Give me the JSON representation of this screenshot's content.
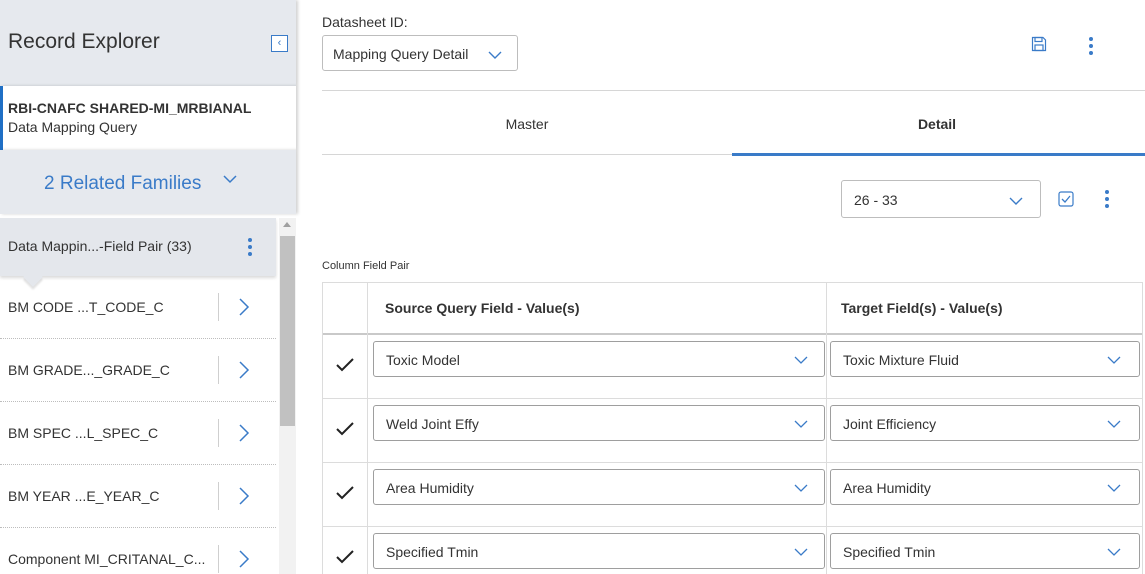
{
  "explorer": {
    "title": "Record Explorer",
    "record": {
      "id": "RBI-CNAFC SHARED-MI_MRBIANAL",
      "type": "Data Mapping Query"
    },
    "related_families_label": "2 Related Families",
    "families": [
      {
        "label": "Data Mappin...-Field Pair",
        "count": "(33)",
        "active": true
      },
      {
        "label": "BM CODE ...T_CODE_C"
      },
      {
        "label": "BM GRADE..._GRADE_C"
      },
      {
        "label": "BM SPEC ...L_SPEC_C"
      },
      {
        "label": "BM YEAR ...E_YEAR_C"
      },
      {
        "label": "Component MI_CRITANAL_C..."
      }
    ]
  },
  "datasheet": {
    "label": "Datasheet ID:",
    "selected": "Mapping Query Detail"
  },
  "tabs": [
    {
      "label": "Master",
      "active": false
    },
    {
      "label": "Detail",
      "active": true
    }
  ],
  "range_select": {
    "value": "26 - 33"
  },
  "section_label": "Column Field Pair",
  "grid": {
    "headers": [
      "Source Query Field - Value(s)",
      "Target Field(s) - Value(s)"
    ],
    "rows": [
      {
        "checked": true,
        "source": "Toxic Model",
        "target": "Toxic Mixture Fluid"
      },
      {
        "checked": true,
        "source": "Weld Joint Effy",
        "target": "Joint Efficiency"
      },
      {
        "checked": true,
        "source": "Area Humidity",
        "target": "Area Humidity"
      },
      {
        "checked": true,
        "source": "Specified Tmin",
        "target": "Specified Tmin"
      }
    ]
  },
  "colors": {
    "accent": "#3a7bc8",
    "panel_bg": "#e6e9ee",
    "active_border": "#1f6fc5"
  },
  "icons": [
    "collapse-icon",
    "chevron-down-icon",
    "kebab-icon",
    "chevron-right-icon",
    "save-icon",
    "checkbox-icon",
    "checkmark-icon"
  ]
}
